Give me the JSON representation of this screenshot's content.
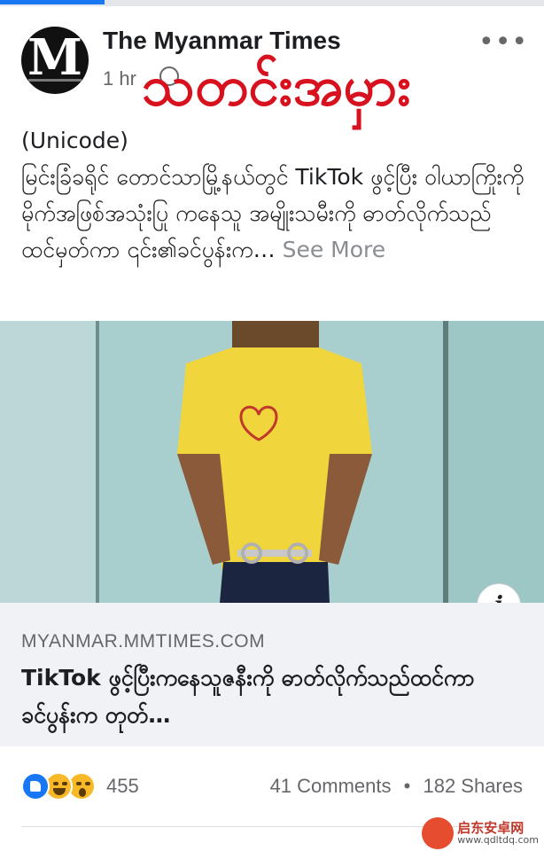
{
  "page": {
    "name": "The Myanmar Times",
    "time": "1 hr",
    "avatar_letter": "M"
  },
  "overlay_title": "သတင်းအမှား",
  "post": {
    "text": "(Unicode)\nမြင်းခြံခရိုင် တောင်သာမြို့နယ်တွင် TikTok ဖွင့်ပြီး ဝါယာကြိုးကိုမိုက်အဖြစ်အသုံးပြု ကနေသူ အမျိုးသမီးကို ဓာတ်လိုက်သည်ထင်မှတ်ကာ ၎င်း၏ခင်ပွန်းက…",
    "see_more": "See More"
  },
  "link_preview": {
    "domain": "MYANMAR.MMTIMES.COM",
    "title": "TikTok ဖွင့်ပြီးကနေသူဇနီးကို ဓာတ်လိုက်သည်ထင်ကာ ခင်ပွန်းက တုတ်…"
  },
  "stats": {
    "reactions_count": "455",
    "comments": "41 Comments",
    "shares": "182 Shares",
    "separator": "•"
  },
  "watermark": {
    "cn": "启东安卓网",
    "url": "www.qdltdq.com"
  },
  "colors": {
    "accent": "#1877f2",
    "overlay_red": "#d8111f",
    "secondary_text": "#65676b"
  }
}
